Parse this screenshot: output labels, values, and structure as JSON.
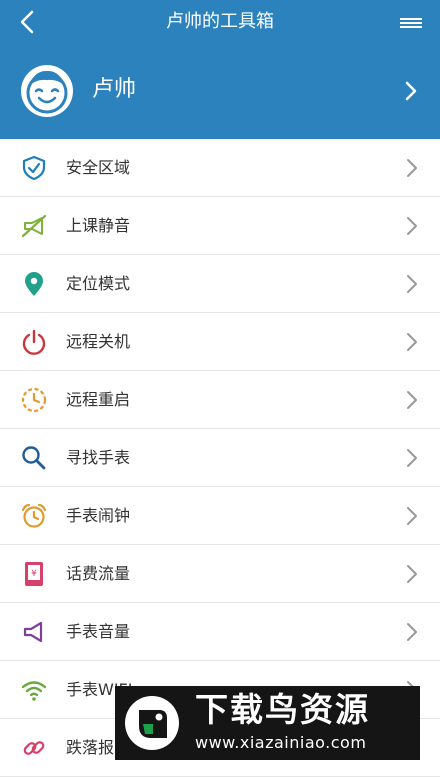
{
  "header": {
    "title": "卢帅的工具箱",
    "accent_color": "#2b82bd"
  },
  "profile": {
    "name": "卢帅",
    "avatar_icon": "smiley-face-avatar"
  },
  "menu": {
    "items": [
      {
        "label": "安全区域",
        "icon": "shield-check-icon",
        "color": "#1e7fb8"
      },
      {
        "label": "上课静音",
        "icon": "mute-speaker-icon",
        "color": "#7db33a"
      },
      {
        "label": "定位模式",
        "icon": "location-pin-icon",
        "color": "#21a08c"
      },
      {
        "label": "远程关机",
        "icon": "power-icon",
        "color": "#c8373e"
      },
      {
        "label": "远程重启",
        "icon": "restart-clock-icon",
        "color": "#e29a2f"
      },
      {
        "label": "寻找手表",
        "icon": "search-icon",
        "color": "#1e5c9a"
      },
      {
        "label": "手表闹钟",
        "icon": "alarm-clock-icon",
        "color": "#e29a2f"
      },
      {
        "label": "话费流量",
        "icon": "phone-credit-icon",
        "color": "#d6406a"
      },
      {
        "label": "手表音量",
        "icon": "volume-icon",
        "color": "#7e3f98"
      },
      {
        "label": "手表WIFI",
        "icon": "wifi-icon",
        "color": "#6aa83b"
      },
      {
        "label": "跌落报",
        "icon": "link-icon",
        "color": "#d6406a"
      }
    ]
  },
  "watermark": {
    "title": "下载鸟资源",
    "url": "www.xiazainiao.com"
  }
}
